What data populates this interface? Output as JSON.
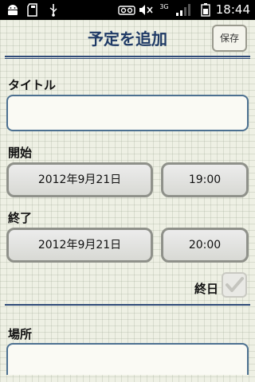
{
  "status_bar": {
    "time": "18:44",
    "network": "3G",
    "icons": [
      "android-icon",
      "sd-card-icon",
      "usb-icon",
      "voicemail-icon",
      "mute-icon",
      "signal-icon",
      "battery-icon"
    ]
  },
  "header": {
    "title": "予定を追加",
    "save_label": "保存"
  },
  "form": {
    "title_label": "タイトル",
    "title_value": "",
    "start_label": "開始",
    "start_date": "2012年9月21日",
    "start_time": "19:00",
    "end_label": "終了",
    "end_date": "2012年9月21日",
    "end_time": "20:00",
    "allday_label": "終日",
    "allday_checked": true,
    "location_label": "場所",
    "location_value": ""
  },
  "colors": {
    "accent": "#1f3a66",
    "divider": "#2e4a78",
    "field_border": "#4c7090"
  }
}
